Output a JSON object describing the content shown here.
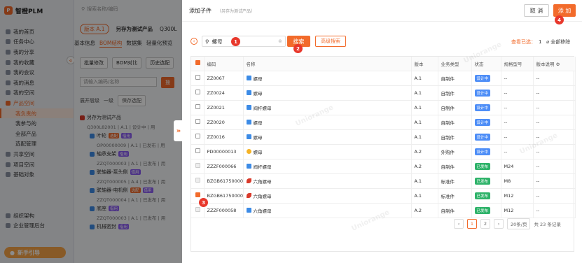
{
  "app": {
    "name": "智橙PLM",
    "logo_letter": "P",
    "search_placeholder": "搜索名称/编码"
  },
  "sidebar": {
    "items": [
      {
        "label": "我的首页"
      },
      {
        "label": "任务中心"
      },
      {
        "label": "我的分享"
      },
      {
        "label": "我的收藏"
      },
      {
        "label": "我的会议"
      },
      {
        "label": "我的消息"
      },
      {
        "label": "我的空间"
      },
      {
        "label": "产品空间",
        "active": true
      },
      {
        "label": "我负责的",
        "sub": true,
        "selected": true
      },
      {
        "label": "我参与的",
        "sub": true
      },
      {
        "label": "全部产品",
        "sub": true
      },
      {
        "label": "选配管理",
        "sub": true
      },
      {
        "label": "共享空间"
      },
      {
        "label": "项目空间"
      },
      {
        "label": "基础对象"
      },
      {
        "label": "组织架构"
      },
      {
        "label": "企业管理后台"
      }
    ],
    "guide_label": "新手引导"
  },
  "middle": {
    "version_label": "版本 A.1",
    "product_title": "另存为测试产品",
    "product_code": "Q300L",
    "tabs": [
      "基本信息",
      "BOM结构",
      "数据集",
      "轻量化预览"
    ],
    "buttons": {
      "batch": "批量修改",
      "compare": "BOM对比",
      "history": "历史选配",
      "search": "搜"
    },
    "search_placeholder": "请输入编码/名称",
    "expand_level": "展开层级",
    "level": "一级",
    "save_config": "保存选配",
    "tree": [
      {
        "name": "另存为测试产品",
        "code": "Q300L82001 | A.1 | 设计中 | 用"
      },
      {
        "name": "叶轮",
        "tags": [
          "选配",
          "借用"
        ],
        "code": "OP00000009 | A.1 | 已发布 | 用"
      },
      {
        "name": "轴承支架",
        "tags": [
          "借用"
        ],
        "code": "ZZQT000003 | A.1 | 已发布 | 用"
      },
      {
        "name": "联轴器-泵头侧",
        "tags": [
          "借用"
        ],
        "code": "ZZQT000005 | A.4 | 已发布 | 用"
      },
      {
        "name": "联轴器-电机侧",
        "tags": [
          "选配",
          "借用"
        ],
        "code": "ZZQT000004 | A.1 | 已发布 | 用"
      },
      {
        "name": "底座",
        "tags": [
          "借用"
        ],
        "code": "ZZQT000003 | A.1 | 已发布 | 用"
      },
      {
        "name": "机械密封",
        "tags": [
          "借用"
        ],
        "code": ""
      }
    ]
  },
  "drawer": {
    "title": "添加子件",
    "subtitle": "（另存为测试产品）",
    "cancel_label": "取 消",
    "add_label": "添 加",
    "search_value": "螺母",
    "search_button": "搜索",
    "advanced_button": "高级搜索",
    "selected_label": "查看已选：",
    "selected_count": "1",
    "remove_all": "全部移除",
    "columns": [
      "编码",
      "名称",
      "版本",
      "业务类型",
      "状态",
      "规格型号",
      "版本说明"
    ],
    "rows": [
      {
        "code": "ZZ0067",
        "name": "螺母",
        "icon": "blue",
        "version": "A.1",
        "type": "自制件",
        "status": "设计中",
        "status_kind": "des",
        "spec": "--",
        "note": "--",
        "check": "off"
      },
      {
        "code": "ZZ0024",
        "name": "螺母",
        "icon": "blue",
        "version": "A.1",
        "type": "自制件",
        "status": "设计中",
        "status_kind": "des",
        "spec": "--",
        "note": "--",
        "check": "off"
      },
      {
        "code": "ZZ0021",
        "name": "阀杆螺母",
        "icon": "blue",
        "version": "A.1",
        "type": "自制件",
        "status": "设计中",
        "status_kind": "des",
        "spec": "--",
        "note": "--",
        "check": "off"
      },
      {
        "code": "ZZ0020",
        "name": "螺母",
        "icon": "blue",
        "version": "A.1",
        "type": "自制件",
        "status": "设计中",
        "status_kind": "des",
        "spec": "--",
        "note": "--",
        "check": "off"
      },
      {
        "code": "ZZ0016",
        "name": "螺母",
        "icon": "blue",
        "version": "A.1",
        "type": "自制件",
        "status": "设计中",
        "status_kind": "des",
        "spec": "--",
        "note": "--",
        "check": "off"
      },
      {
        "code": "PD00000013",
        "name": "螺母",
        "icon": "yel",
        "version": "A.2",
        "type": "外购件",
        "status": "设计中",
        "status_kind": "des",
        "spec": "--",
        "note": "--",
        "check": "off"
      },
      {
        "code": "ZZZF000066",
        "name": "阀杆螺母",
        "icon": "blue",
        "version": "A.2",
        "type": "自制件",
        "status": "已发布",
        "status_kind": "pub",
        "spec": "M24",
        "note": "--",
        "check": "dis"
      },
      {
        "code": "BZGB6175000066",
        "name": "六角螺母",
        "icon": "red",
        "version": "A.1",
        "type": "标准件",
        "status": "已发布",
        "status_kind": "pub",
        "spec": "M8",
        "note": "--",
        "check": "dis"
      },
      {
        "code": "BZGB6175000061",
        "name": "六角螺母",
        "icon": "red",
        "version": "A.1",
        "type": "标准件",
        "status": "已发布",
        "status_kind": "pub",
        "spec": "M12",
        "note": "--",
        "check": "on"
      },
      {
        "code": "ZZZF000058",
        "name": "六角螺母",
        "icon": "blue",
        "version": "A.2",
        "type": "自制件",
        "status": "已发布",
        "status_kind": "pub",
        "spec": "M12",
        "note": "--",
        "check": "dis"
      }
    ],
    "pager": {
      "pages": [
        "1",
        "2"
      ],
      "current": "1",
      "page_size": "20条/页",
      "total": "共 23 条记录"
    },
    "markers": [
      "1",
      "2",
      "3",
      "4"
    ],
    "watermark": "Uniorange"
  },
  "colors": {
    "accent": "#f26b2b",
    "marker": "#e8382c",
    "design_status": "#4e8ef7",
    "published_status": "#2fb36a"
  }
}
